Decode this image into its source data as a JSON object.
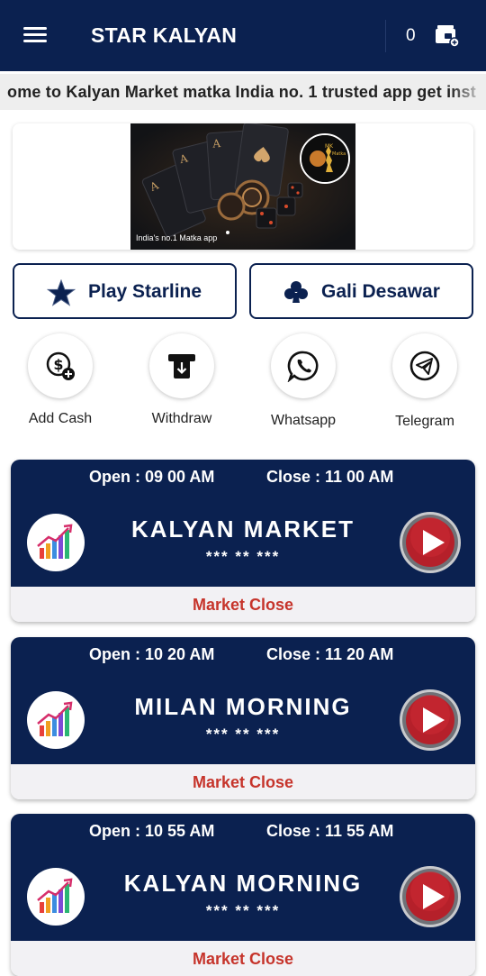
{
  "app": {
    "title": "STAR KALYAN",
    "wallet_balance": "0",
    "colors": {
      "primary": "#0b2150",
      "status_closed": "#c6342b",
      "marquee_bg": "#eeeeee"
    }
  },
  "marquee": {
    "text": "ome to Kalyan Market matka India no. 1 trusted app get inst"
  },
  "banner": {
    "caption": "India's no.1 Matka app",
    "logo_text": "MK Matka"
  },
  "game_buttons": {
    "starline": {
      "label": "Play Starline",
      "icon": "star-icon"
    },
    "gali": {
      "label": "Gali Desawar",
      "icon": "club-icon"
    }
  },
  "quick_actions": [
    {
      "label": "Add Cash",
      "icon": "add-cash-icon"
    },
    {
      "label": "Withdraw",
      "icon": "withdraw-icon"
    },
    {
      "label": "Whatsapp",
      "icon": "whatsapp-icon"
    },
    {
      "label": "Telegram",
      "icon": "telegram-icon"
    }
  ],
  "markets": [
    {
      "open": "Open : 09 00 AM",
      "close": "Close : 11 00 AM",
      "name": "KALYAN MARKET",
      "result": "*** ** ***",
      "status": "Market Close"
    },
    {
      "open": "Open : 10 20 AM",
      "close": "Close : 11 20 AM",
      "name": "MILAN MORNING",
      "result": "*** ** ***",
      "status": "Market Close"
    },
    {
      "open": "Open : 10 55 AM",
      "close": "Close : 11 55 AM",
      "name": "KALYAN MORNING",
      "result": "*** ** ***",
      "status": "Market Close"
    }
  ]
}
